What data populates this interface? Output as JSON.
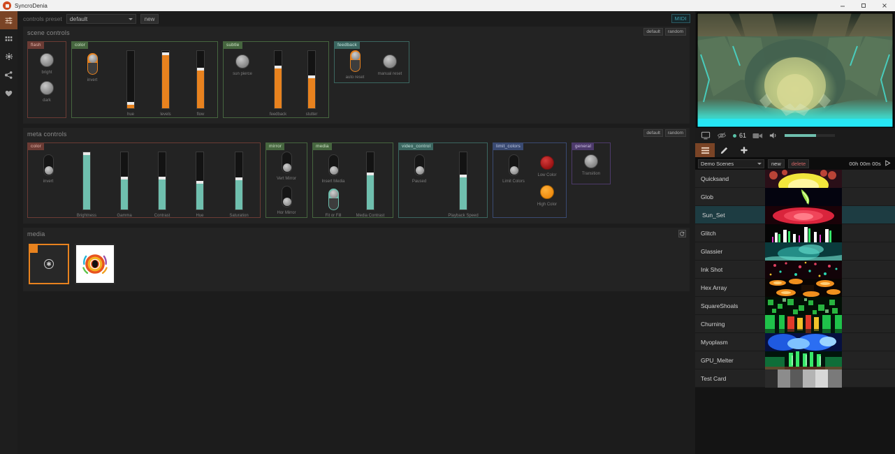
{
  "window": {
    "title": "SyncroDenia",
    "app_icon": "app-icon",
    "controls": {
      "minimize": "─",
      "maximize": "▭",
      "close": "✕"
    }
  },
  "rail": {
    "items": [
      {
        "name": "sliders-icon",
        "active": true
      },
      {
        "name": "grid-icon",
        "active": false
      },
      {
        "name": "gear-icon",
        "active": false
      },
      {
        "name": "share-icon",
        "active": false
      },
      {
        "name": "heart-icon",
        "active": false
      }
    ]
  },
  "preset_bar": {
    "label": "controls preset",
    "selected": "default",
    "new_label": "new",
    "midi_badge": "MIDI"
  },
  "scene_controls": {
    "title": "scene controls",
    "default_label": "default",
    "random_label": "random",
    "groups": [
      {
        "name": "flash",
        "color": "g-red",
        "knobs": [
          {
            "label": "bright"
          },
          {
            "label": "dark"
          }
        ],
        "stacked": true
      },
      {
        "name": "color",
        "color": "g-green",
        "toggles": [
          {
            "label": "invert",
            "state": "on"
          }
        ],
        "sliders": [
          {
            "label": "hue",
            "value": 8,
            "color": "#e8821e"
          },
          {
            "label": "levels",
            "value": 95,
            "color": "#e8821e"
          },
          {
            "label": "flow",
            "value": 68,
            "color": "#e8821e"
          }
        ]
      },
      {
        "name": "subtle",
        "color": "g-green",
        "knobs": [
          {
            "label": "sun pierce"
          }
        ],
        "sliders": [
          {
            "label": "feedback",
            "value": 72,
            "color": "#e8821e"
          },
          {
            "label": "stutter",
            "value": 55,
            "color": "#e8821e"
          }
        ]
      },
      {
        "name": "feedback",
        "color": "g-teal",
        "toggles": [
          {
            "label": "auto reset",
            "state": "on"
          }
        ],
        "knobs": [
          {
            "label": "manual reset"
          }
        ]
      }
    ]
  },
  "meta_controls": {
    "title": "meta controls",
    "default_label": "default",
    "random_label": "random",
    "groups": [
      {
        "name": "color",
        "color": "g-red",
        "toggles": [
          {
            "label": "invert",
            "state": "off"
          }
        ],
        "sliders": [
          {
            "label": "Brightness",
            "value": 97,
            "color": "#6fbfae"
          },
          {
            "label": "Gamma",
            "value": 55,
            "color": "#6fbfae"
          },
          {
            "label": "Contrast",
            "value": 55,
            "color": "#6fbfae"
          },
          {
            "label": "Hue",
            "value": 48,
            "color": "#6fbfae"
          },
          {
            "label": "Saturation",
            "value": 54,
            "color": "#6fbfae"
          }
        ]
      },
      {
        "name": "mirror",
        "color": "g-green",
        "toggles_stacked": [
          {
            "label": "Vert Mirror",
            "state": "off"
          },
          {
            "label": "Hor Mirror",
            "state": "off"
          }
        ]
      },
      {
        "name": "media",
        "color": "g-green",
        "toggles_stacked": [
          {
            "label": "Insert Media",
            "state": "off"
          },
          {
            "label": "Fit or Fill",
            "state": "teal-on"
          }
        ],
        "sliders": [
          {
            "label": "Media Contrast",
            "value": 62,
            "color": "#6fbfae"
          }
        ]
      },
      {
        "name": "video_control",
        "color": "g-teal",
        "toggles": [
          {
            "label": "Paused",
            "state": "off"
          }
        ],
        "sliders": [
          {
            "label": "Playback Speed",
            "value": 58,
            "color": "#6fbfae"
          }
        ]
      },
      {
        "name": "limit_colors",
        "color": "g-blue",
        "toggles": [
          {
            "label": "Limit Colors",
            "state": "off"
          }
        ],
        "knobs_colored": [
          {
            "label": "Low Color",
            "color": "red"
          },
          {
            "label": "High Color",
            "color": "orange"
          }
        ]
      },
      {
        "name": "general",
        "color": "g-purple",
        "knobs": [
          {
            "label": "Transition"
          }
        ]
      }
    ]
  },
  "media_section": {
    "title": "media",
    "tiles": [
      {
        "name": "empty-media-tile",
        "selected": true,
        "icon": "add-media-icon"
      },
      {
        "name": "logo-media-tile",
        "selected": false,
        "icon": "eye-logo-icon"
      }
    ]
  },
  "preview": {
    "name": "output-preview",
    "tools": {
      "monitor_icon": "monitor-icon",
      "eye_off_icon": "eye-off-icon",
      "fps": "61",
      "camera_icon": "camera-icon",
      "volume_icon": "volume-icon",
      "volume_value": 62
    }
  },
  "scene_panel": {
    "tabs": [
      {
        "name": "list-tab",
        "icon": "list-icon",
        "active": true
      },
      {
        "name": "edit-tab",
        "icon": "pencil-icon",
        "active": false
      },
      {
        "name": "add-tab",
        "icon": "plus-icon",
        "active": false
      }
    ],
    "collection": "Demo Scenes",
    "new_label": "new",
    "delete_label": "delete",
    "timer": "00h 00m 00s",
    "play_icon": "play-icon",
    "scenes": [
      {
        "name": "Quicksand",
        "selected": false,
        "thumb": "quicksand"
      },
      {
        "name": "Glob",
        "selected": false,
        "thumb": "glob"
      },
      {
        "name": "Sun_Set",
        "selected": true,
        "thumb": "sunset"
      },
      {
        "name": "Glitch",
        "selected": false,
        "thumb": "glitch"
      },
      {
        "name": "Glassier",
        "selected": false,
        "thumb": "glassier"
      },
      {
        "name": "Ink Shot",
        "selected": false,
        "thumb": "inkshot"
      },
      {
        "name": "Hex Array",
        "selected": false,
        "thumb": "hexarray"
      },
      {
        "name": "SquareShoals",
        "selected": false,
        "thumb": "squareshoals"
      },
      {
        "name": "Churning",
        "selected": false,
        "thumb": "churning"
      },
      {
        "name": "Myoplasm",
        "selected": false,
        "thumb": "myoplasm"
      },
      {
        "name": "GPU_Melter",
        "selected": false,
        "thumb": "gpumelter"
      },
      {
        "name": "Test Card",
        "selected": false,
        "thumb": "testcard"
      }
    ]
  }
}
